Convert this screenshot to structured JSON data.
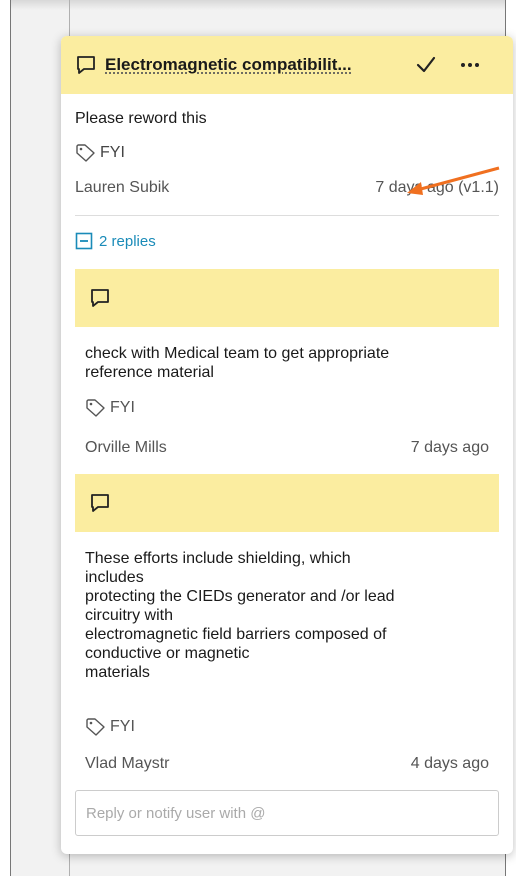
{
  "comment": {
    "title": "Electromagnetic compatibilit...",
    "text": "Please reword this",
    "tag": "FYI",
    "author": "Lauren Subik",
    "timestamp": "7 days ago (v1.1)"
  },
  "replies_toggle": {
    "label": "2 replies"
  },
  "replies": [
    {
      "text_lines": [
        "check with Medical team to get appropriate",
        "reference material"
      ],
      "tag": "FYI",
      "author": "Orville Mills",
      "timestamp": "7 days ago"
    },
    {
      "text_lines": [
        "These efforts include shielding, which",
        "includes",
        "protecting the CIEDs generator and /or lead",
        "circuitry with",
        "electromagnetic field barriers composed of",
        "conductive or magnetic",
        "materials"
      ],
      "tag": "FYI",
      "author": "Vlad Maystr",
      "timestamp": "4 days ago"
    }
  ],
  "reply_input": {
    "placeholder": "Reply or notify user with @",
    "value": ""
  },
  "icons": {
    "header_comment": "comment-icon",
    "resolve": "checkmark-icon",
    "more": "ellipsis-icon",
    "tag": "tag-icon",
    "collapse": "collapse-box-icon",
    "reply_comment": "comment-icon",
    "arrow": "connector-arrow-icon"
  },
  "colors": {
    "header_bg": "#fbeda0",
    "link": "#1a8bb8",
    "arrow": "#f07020"
  }
}
